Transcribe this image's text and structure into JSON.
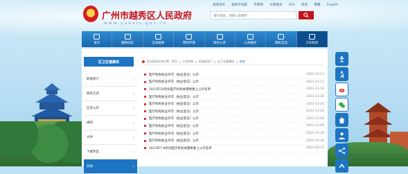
{
  "header": {
    "site_title": "广州市越秀区人民政府",
    "site_url": "www.yuexiu.gov.cn",
    "top_links": [
      "越秀发布",
      "越秀手机版",
      "无障碍",
      "长者模式",
      "RSS",
      "简体",
      "繁體",
      "English"
    ],
    "search_placeholder": "请在搜索...请输入关键字",
    "colors": {
      "title": "#c4141b",
      "nav": "#1a67ad",
      "accent": "#d43030"
    }
  },
  "nav": {
    "items": [
      {
        "label": "首页",
        "icon": "home-icon"
      },
      {
        "label": "越秀动态",
        "icon": "news-icon"
      },
      {
        "label": "走进越秀",
        "icon": "building-icon"
      },
      {
        "label": "营商环境",
        "icon": "briefcase-icon"
      },
      {
        "label": "政务公开",
        "icon": "document-icon"
      },
      {
        "label": "公共服务",
        "icon": "service-icon"
      },
      {
        "label": "政民互动",
        "icon": "chat-icon"
      },
      {
        "label": "工作机构",
        "icon": "institution-icon"
      }
    ],
    "active_index": 7
  },
  "sidebar": {
    "head": "区卫生健康局",
    "items": [
      {
        "label": "职能简介"
      },
      {
        "label": "联系方式"
      },
      {
        "label": "信息公开"
      },
      {
        "label": "通知"
      },
      {
        "label": "文件"
      },
      {
        "label": "下载专区"
      },
      {
        "label": "其他"
      }
    ]
  },
  "breadcrumb": {
    "prefix": "您当前所在的位置：",
    "items": [
      "首页",
      "工作机构",
      "区政府部门",
      "区卫生健康局",
      "其他"
    ]
  },
  "list": {
    "rows": [
      {
        "title": "医疗机构执业许可（执业登记）公示",
        "date": "2023-12-11"
      },
      {
        "title": "医疗机构执业许可（执业登记）公示",
        "date": "2023-12-11"
      },
      {
        "title": "2023年10月份医疗机构关键要素上公示名单",
        "date": "2023-11-30"
      },
      {
        "title": "医疗机构执业许可（执业登记）公示",
        "date": "2023-11-20"
      },
      {
        "title": "医疗机构执业许可（执业登记）公示",
        "date": "2023-11-20"
      },
      {
        "title": "医疗机构执业许可（执业登记）公示",
        "date": "2023-11-20"
      },
      {
        "title": "医疗机构执业许可（执业登记）公示",
        "date": "2023-11-06"
      },
      {
        "title": "医疗机构执业许可（执业登记）公示",
        "date": "2023-11-06"
      },
      {
        "title": "医疗机构执业许可（执业登记）公示",
        "date": "2023-10-30"
      },
      {
        "title": "医疗机构执业许可（执业登记）公示",
        "date": "2023-10-30"
      },
      {
        "title": "2023年7-8月份医疗机构关键要素上公示名单",
        "date": "2023-09-22"
      }
    ]
  },
  "toolbar": {
    "buttons": [
      "accessibility-icon",
      "elder-icon",
      "weibo-icon",
      "wechat-icon",
      "house-icon",
      "person-icon",
      "share-icon",
      "up-icon"
    ]
  }
}
